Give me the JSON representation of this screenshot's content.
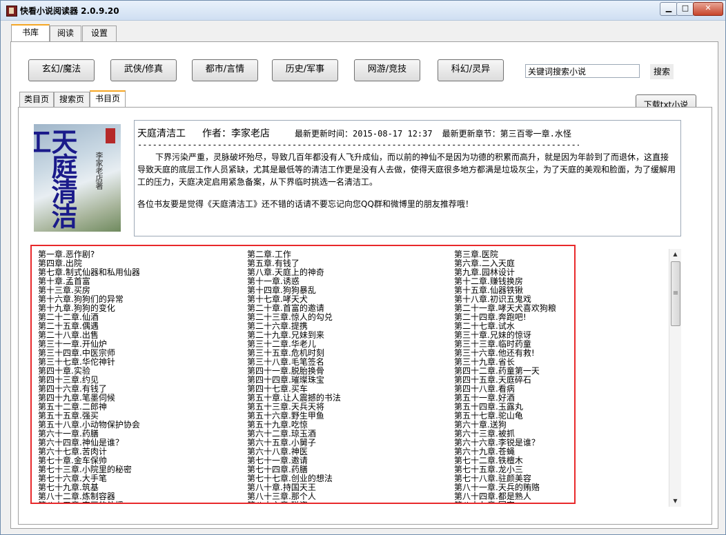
{
  "window": {
    "title": "快看小说阅读器 2.0.9.20",
    "min_glyph": "▁",
    "max_glyph": "□",
    "close_glyph": "✕"
  },
  "main_tabs": [
    "书库",
    "阅读",
    "设置"
  ],
  "categories": [
    "玄幻/魔法",
    "武侠/修真",
    "都市/言情",
    "历史/军事",
    "网游/竞技",
    "科幻/灵异"
  ],
  "search": {
    "value": "关键词搜索小说",
    "button": "搜索"
  },
  "sub_tabs": [
    "类目页",
    "搜索页",
    "书目页"
  ],
  "download_button": "下载txt小说",
  "book": {
    "cover_title": "天庭清洁工",
    "cover_author": "李家老店著",
    "title": "天庭清洁工",
    "author": "作者：李家老店",
    "update_time": "最新更新时间：2015-08-17 12:37",
    "latest_chapter": "最新更新章节：第三百零一章.水怪",
    "separator": "---------------------------------------------------------------------------------------------------------",
    "description": "下界污染严重，灵脉破坏殆尽，导致几百年都没有人飞升成仙，而以前的神仙不是因为功德的积累而高升，就是因为年龄到了而退休，这直接导致天庭的底层工作人员紧缺，尤其是最低等的清洁工作更是没有人去做，使得天庭很多地方都满是垃圾灰尘，为了天庭的美观和脸面，为了缓解用工的压力，天庭决定启用紧急备案，从下界临时挑选一名清洁工。",
    "recommend": "各位书友要是觉得《天庭清洁工》还不错的话请不要忘记向您QQ群和微博里的朋友推荐哦！"
  },
  "chapters": {
    "col1": [
      "第一章.恶作剧?",
      "第四章.出院",
      "第七章.制式仙器和私用仙器",
      "第十章.孟首富",
      "第十三章.买房",
      "第十六章.狗狗们的异常",
      "第十九章.狗狗的变化",
      "第二十二章.仙酒",
      "第二十五章.偶遇",
      "第二十八章.出售",
      "第三十一章.开仙炉",
      "第三十四章.中医宗师",
      "第三十七章.华佗神针",
      "第四十章.实验",
      "第四十三章.约见",
      "第四十六章.有钱了",
      "第四十九章.笔墨伺候",
      "第五十二章.二郎神",
      "第五十五章.强买",
      "第五十八章.小动物保护协会",
      "第六十一章.药膳",
      "第六十四章.神仙是谁？",
      "第六十七章.苦肉计",
      "第七十章.金车保帅",
      "第七十三章.小院里的秘密",
      "第七十六章.大手笔",
      "第七十九章.筑基",
      "第八十二章.炼制容器",
      "第八十五章.字画的外援"
    ],
    "col2": [
      "第二章.工作",
      "第五章.有钱了",
      "第八章.天庭上的神奇",
      "第十一章.诱惑",
      "第十四章.狗狗暴乱",
      "第十七章.哮天犬",
      "第二十章.首富的邀请",
      "第二十三章.惊人的勾兑",
      "第二十六章.提携",
      "第二十九章.兄妹到来",
      "第三十二章.华老儿",
      "第三十五章.危机时刻",
      "第三十八章.毛笔签名",
      "第四十一章.脱胎换骨",
      "第四十四章.璀璨珠宝",
      "第四十七章.买车",
      "第五十章.让人震撼的书法",
      "第五十三章.天兵天将",
      "第五十六章.野生甲鱼",
      "第五十九章.吃惊",
      "第六十二章.琼玉酒",
      "第六十五章.小舅子",
      "第六十八章.神医",
      "第七十一章.邀请",
      "第七十四章.药膳",
      "第七十七章.创业的想法",
      "第八十章.持国天王",
      "第八十三章.那个人",
      "第八十六章.碰瓷"
    ],
    "col3": [
      "第三章.医院",
      "第六章.二入天庭",
      "第九章.园林设计",
      "第十二章.赚钱换房",
      "第十五章.仙器铁锹",
      "第十八章.初识五鬼戏",
      "第二十一章.哮天犬喜欢狗粮",
      "第二十四章.奔跑吧!",
      "第二十七章.试水",
      "第三十章.兄妹的惊讶",
      "第三十三章.临时药童",
      "第三十六章.他还有救!",
      "第三十九章.省长",
      "第四十二章.药童第一天",
      "第四十五章.天庭碎石",
      "第四十八章.看病",
      "第五十一章.好酒",
      "第五十四章.玉露丸",
      "第五十七章.驼山龟",
      "第六十章.送狗",
      "第六十三章.被抓",
      "第六十六章.李锐是谁？",
      "第六十九章.苍蝇",
      "第七十二章.铁檀木",
      "第七十五章.龙小三",
      "第七十八章.驻颜美容",
      "第八十一章.天兵的贿赂",
      "第八十四章.都是熟人",
      "第八十七章.回家"
    ]
  },
  "scrollbar": {
    "up_glyph": "▲",
    "down_glyph": "▼",
    "grip_glyph": "≡"
  }
}
